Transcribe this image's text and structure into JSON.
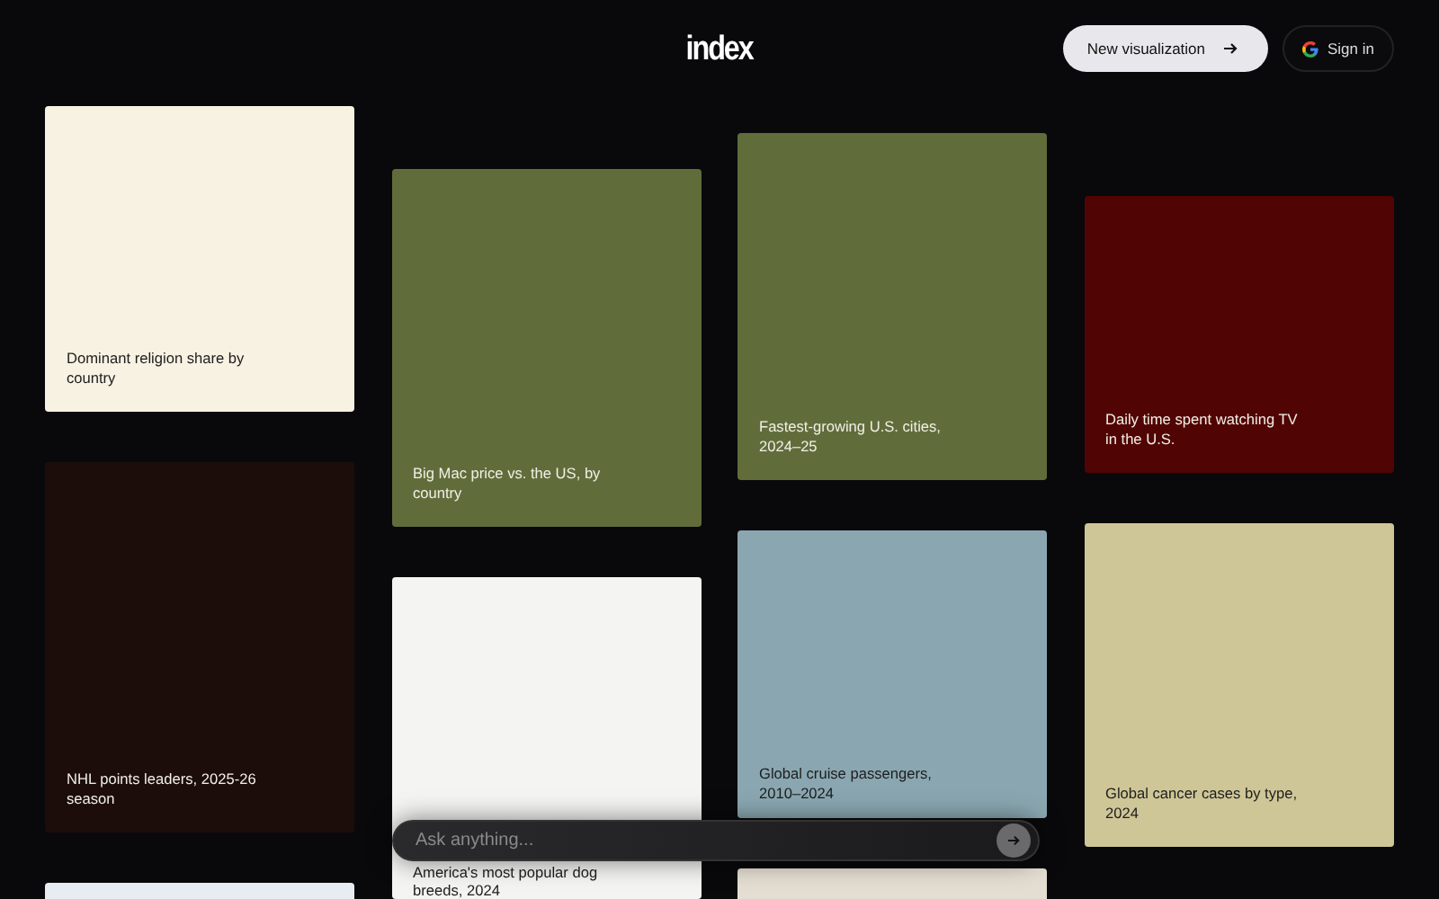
{
  "header": {
    "logo": "index",
    "new_button": {
      "label": "New visualization"
    },
    "sign_in": {
      "label": "Sign in"
    }
  },
  "columns": [
    {
      "cards": [
        {
          "title": "Dominant religion share by country",
          "color": "#f8f2e3"
        },
        {
          "title": "NHL points leaders, 2025-26 season",
          "color": "#1c0d0b"
        },
        {
          "color": "#e8edf3"
        }
      ]
    },
    {
      "cards": [
        {
          "title": "Big Mac price vs. the US, by country",
          "color": "#606d3b"
        },
        {
          "title": "America's most popular dog breeds, 2024",
          "color": "#f4f4f2"
        }
      ]
    },
    {
      "cards": [
        {
          "title": "Fastest-growing U.S. cities, 2024–25",
          "color": "#606d3b"
        },
        {
          "title": "Global cruise passengers, 2010–2024",
          "color": "#8aa7b1"
        },
        {
          "color": "#e4ddd2"
        }
      ]
    },
    {
      "cards": [
        {
          "title": "Daily time spent watching TV in the U.S.",
          "color": "#510404"
        },
        {
          "title": "Global cancer cases by type, 2024",
          "color": "#cfc697"
        }
      ]
    }
  ],
  "search": {
    "placeholder": "Ask anything..."
  }
}
